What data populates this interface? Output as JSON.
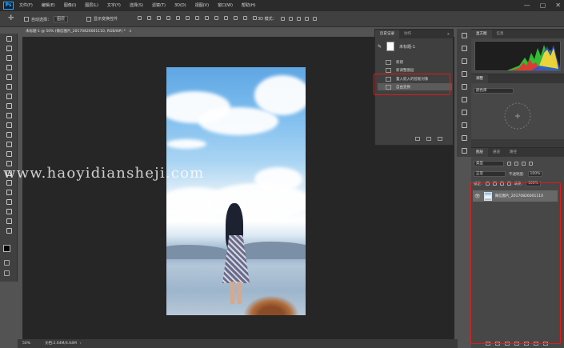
{
  "app": {
    "logo": "Ps"
  },
  "menus": [
    "文件(F)",
    "编辑(E)",
    "图像(I)",
    "图层(L)",
    "文字(Y)",
    "选择(S)",
    "滤镜(T)",
    "3D(D)",
    "视图(V)",
    "窗口(W)",
    "帮助(H)"
  ],
  "window_controls": [
    "—",
    "▢",
    "✕"
  ],
  "options": {
    "auto_select_label": "自动选择：",
    "auto_select_value": "图层",
    "show_transform_label": "显示变换控件",
    "mode_3d_label": "3D 模式："
  },
  "document": {
    "tab_title": "未标题-1 @ 50% (微信图片_20170826001110, RGB/8#) *",
    "close": "×"
  },
  "history": {
    "tabs": [
      "历史记录",
      "动作"
    ],
    "snapshot_label": "未标题-1",
    "items": [
      {
        "label": "新建",
        "icon": "document-icon"
      },
      {
        "label": "新调整图层",
        "icon": "adjustment-icon"
      },
      {
        "label": "置入嵌入的智能对象",
        "icon": "place-icon"
      },
      {
        "label": "自由变换",
        "icon": "transform-icon"
      }
    ]
  },
  "right": {
    "histogram_tabs": [
      "直方图",
      "信息"
    ],
    "adjust_tabs": [
      "调整"
    ],
    "adjust_label": "颜色库",
    "layers_tabs": [
      "图层",
      "通道",
      "路径"
    ],
    "filter_type": "类型",
    "blend_mode": "正常",
    "opacity_label": "不透明度:",
    "opacity_value": "100%",
    "lock_label": "锁定:",
    "fill_label": "填充:",
    "fill_value": "100%",
    "layer_name": "微信图片_20170826001110"
  },
  "status": {
    "zoom": "50%",
    "doc_info": "文档:2.64M/4.64M"
  },
  "watermark": "www.haoyidiansheji.com",
  "colors": {
    "highlight": "#e01b1b",
    "canvas_bg": "#262626",
    "panel_bg": "#474747"
  }
}
